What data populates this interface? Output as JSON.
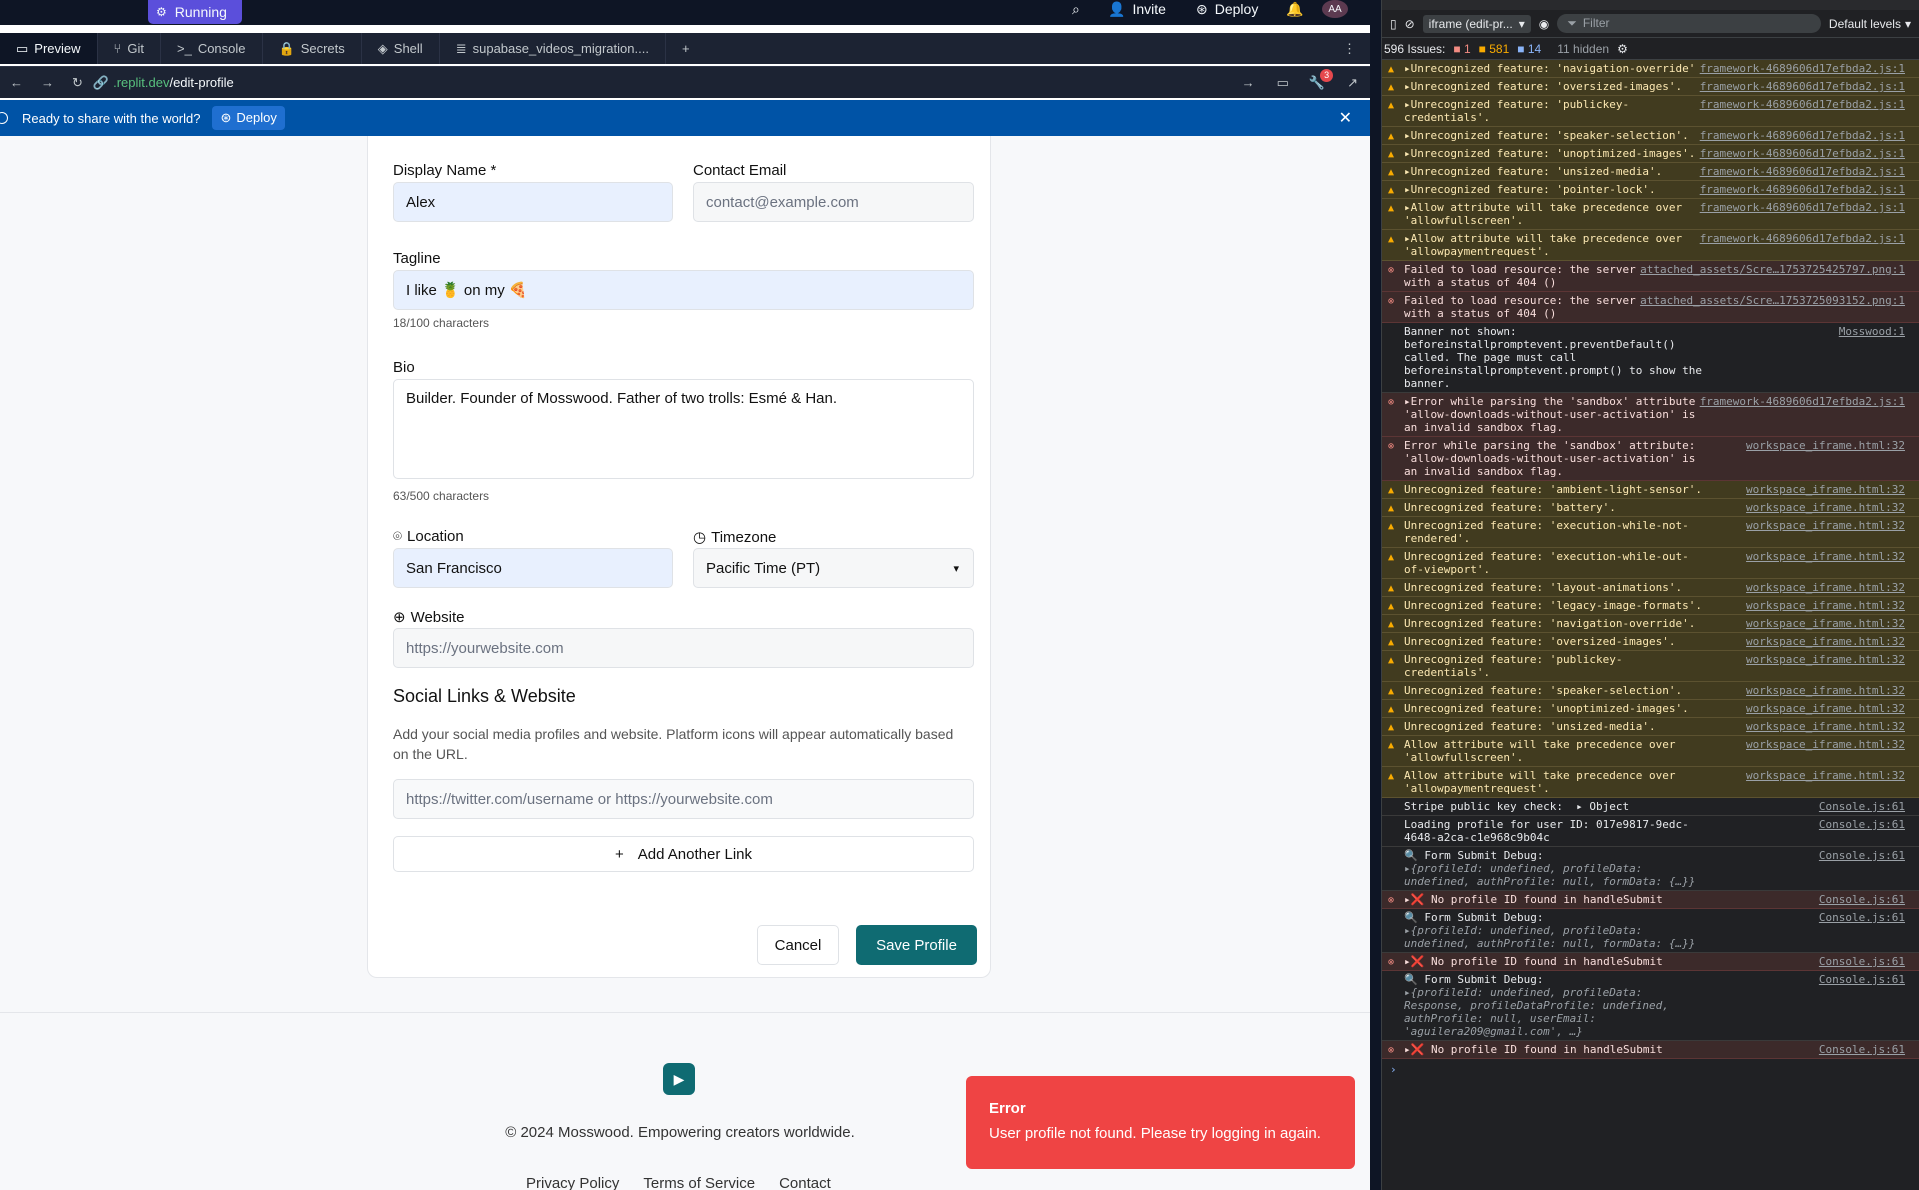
{
  "topbar": {
    "status": "Running",
    "invite": "Invite",
    "deploy": "Deploy",
    "avatar": "AA"
  },
  "tabs": [
    {
      "label": "Preview",
      "icon": "preview-icon"
    },
    {
      "label": "Git",
      "icon": "git-icon"
    },
    {
      "label": "Console",
      "icon": "console-icon"
    },
    {
      "label": "Secrets",
      "icon": "lock-icon"
    },
    {
      "label": "Shell",
      "icon": "shell-icon"
    },
    {
      "label": "supabase_videos_migration....",
      "icon": "database-icon"
    }
  ],
  "url": {
    "host": ".replit.dev",
    "path": "/edit-profile",
    "notify_count": "3"
  },
  "banner": {
    "text": "Ready to share with the world?",
    "deploy": "Deploy"
  },
  "form": {
    "display_name_label": "Display Name *",
    "display_name": "Alex",
    "contact_email_label": "Contact Email",
    "contact_email_placeholder": "contact@example.com",
    "tagline_label": "Tagline",
    "tagline": "I like 🍍 on my 🍕",
    "tagline_count": "18/100 characters",
    "bio_label": "Bio",
    "bio": "Builder. Founder of Mosswood. Father of two trolls: Esmé & Han.",
    "bio_count": "63/500 characters",
    "location_label": "Location",
    "location": "San Francisco",
    "timezone_label": "Timezone",
    "timezone": "Pacific Time (PT)",
    "website_label": "Website",
    "website_placeholder": "https://yourwebsite.com",
    "social_title": "Social Links & Website",
    "social_desc": "Add your social media profiles and website. Platform icons will appear automatically based on the URL.",
    "social_placeholder": "https://twitter.com/username or https://yourwebsite.com",
    "add_link": "Add Another Link",
    "cancel": "Cancel",
    "save": "Save Profile"
  },
  "footer": {
    "copyright": "© 2024 Mosswood. Empowering creators worldwide.",
    "links": [
      "Privacy Policy",
      "Terms of Service",
      "Contact"
    ]
  },
  "toast": {
    "title": "Error",
    "message": "User profile not found. Please try logging in again."
  },
  "devtools": {
    "context": "iframe (edit-pr...",
    "filter_placeholder": "Filter",
    "levels": "Default levels",
    "issues_label": "596 Issues:",
    "issues_errors": "1",
    "issues_warnings": "581",
    "issues_info": "14",
    "hidden": "11 hidden",
    "logs": [
      {
        "type": "warn",
        "msg": "▸Unrecognized feature: 'navigation-override'.",
        "src": "framework-4689606d17efbda2.js:1"
      },
      {
        "type": "warn",
        "msg": "▸Unrecognized feature: 'oversized-images'.",
        "src": "framework-4689606d17efbda2.js:1"
      },
      {
        "type": "warn",
        "msg": "▸Unrecognized feature: 'publickey-credentials'.",
        "src": "framework-4689606d17efbda2.js:1"
      },
      {
        "type": "warn",
        "msg": "▸Unrecognized feature: 'speaker-selection'.",
        "src": "framework-4689606d17efbda2.js:1"
      },
      {
        "type": "warn",
        "msg": "▸Unrecognized feature: 'unoptimized-images'.",
        "src": "framework-4689606d17efbda2.js:1"
      },
      {
        "type": "warn",
        "msg": "▸Unrecognized feature: 'unsized-media'.",
        "src": "framework-4689606d17efbda2.js:1"
      },
      {
        "type": "warn",
        "msg": "▸Unrecognized feature: 'pointer-lock'.",
        "src": "framework-4689606d17efbda2.js:1"
      },
      {
        "type": "warn",
        "msg": "▸Allow attribute will take precedence over 'allowfullscreen'.",
        "src": "framework-4689606d17efbda2.js:1"
      },
      {
        "type": "warn",
        "msg": "▸Allow attribute will take precedence over 'allowpaymentrequest'.",
        "src": "framework-4689606d17efbda2.js:1"
      },
      {
        "type": "error",
        "msg": "Failed to load resource: the server responded with a status of 404 ()",
        "src": "attached_assets/Scre…1753725425797.png:1"
      },
      {
        "type": "error",
        "msg": "Failed to load resource: the server responded with a status of 404 ()",
        "src": "attached_assets/Scre…1753725093152.png:1"
      },
      {
        "type": "info",
        "msg": "Banner not shown: beforeinstallpromptevent.preventDefault() called. The page must call beforeinstallpromptevent.prompt() to show the banner.",
        "src": "Mosswood:1"
      },
      {
        "type": "error",
        "msg": "▸Error while parsing the 'sandbox' attribute: 'allow-downloads-without-user-activation' is an invalid sandbox flag.",
        "src": "framework-4689606d17efbda2.js:1"
      },
      {
        "type": "error",
        "msg": "Error while parsing the 'sandbox' attribute: 'allow-downloads-without-user-activation' is an invalid sandbox flag.",
        "src": "workspace_iframe.html:32"
      },
      {
        "type": "warn",
        "msg": "Unrecognized feature: 'ambient-light-sensor'.",
        "src": "workspace_iframe.html:32"
      },
      {
        "type": "warn",
        "msg": "Unrecognized feature: 'battery'.",
        "src": "workspace_iframe.html:32"
      },
      {
        "type": "warn",
        "msg": "Unrecognized feature: 'execution-while-not-rendered'.",
        "src": "workspace_iframe.html:32"
      },
      {
        "type": "warn",
        "msg": "Unrecognized feature: 'execution-while-out-of-viewport'.",
        "src": "workspace_iframe.html:32"
      },
      {
        "type": "warn",
        "msg": "Unrecognized feature: 'layout-animations'.",
        "src": "workspace_iframe.html:32"
      },
      {
        "type": "warn",
        "msg": "Unrecognized feature: 'legacy-image-formats'.",
        "src": "workspace_iframe.html:32"
      },
      {
        "type": "warn",
        "msg": "Unrecognized feature: 'navigation-override'.",
        "src": "workspace_iframe.html:32"
      },
      {
        "type": "warn",
        "msg": "Unrecognized feature: 'oversized-images'.",
        "src": "workspace_iframe.html:32"
      },
      {
        "type": "warn",
        "msg": "Unrecognized feature: 'publickey-credentials'.",
        "src": "workspace_iframe.html:32"
      },
      {
        "type": "warn",
        "msg": "Unrecognized feature: 'speaker-selection'.",
        "src": "workspace_iframe.html:32"
      },
      {
        "type": "warn",
        "msg": "Unrecognized feature: 'unoptimized-images'.",
        "src": "workspace_iframe.html:32"
      },
      {
        "type": "warn",
        "msg": "Unrecognized feature: 'unsized-media'.",
        "src": "workspace_iframe.html:32"
      },
      {
        "type": "warn",
        "msg": "Allow attribute will take precedence over 'allowfullscreen'.",
        "src": "workspace_iframe.html:32"
      },
      {
        "type": "warn",
        "msg": "Allow attribute will take precedence over 'allowpaymentrequest'.",
        "src": "workspace_iframe.html:32"
      },
      {
        "type": "info",
        "msg": "Stripe public key check:  ▸ Object",
        "src": "Console.js:61"
      },
      {
        "type": "info",
        "msg": "Loading profile for user ID: 017e9817-9edc-4648-a2ca-c1e968c9b04c",
        "src": "Console.js:61"
      },
      {
        "type": "info",
        "msg": "🔍 Form Submit Debug:",
        "sub": "▸{profileId: undefined, profileData: undefined, authProfile: null, formData: {…}}",
        "src": "Console.js:61"
      },
      {
        "type": "error",
        "msg": "▸❌ No profile ID found in handleSubmit",
        "src": "Console.js:61"
      },
      {
        "type": "info",
        "msg": "🔍 Form Submit Debug:",
        "sub": "▸{profileId: undefined, profileData: undefined, authProfile: null, formData: {…}}",
        "src": "Console.js:61"
      },
      {
        "type": "error",
        "msg": "▸❌ No profile ID found in handleSubmit",
        "src": "Console.js:61"
      },
      {
        "type": "info",
        "msg": "🔍 Form Submit Debug:",
        "sub": "▸{profileId: undefined, profileData: Response, profileDataProfile: undefined, authProfile: null, userEmail: 'aguilera209@gmail.com', …}",
        "src": "Console.js:61"
      },
      {
        "type": "error",
        "msg": "▸❌ No profile ID found in handleSubmit",
        "src": "Console.js:61"
      }
    ]
  }
}
